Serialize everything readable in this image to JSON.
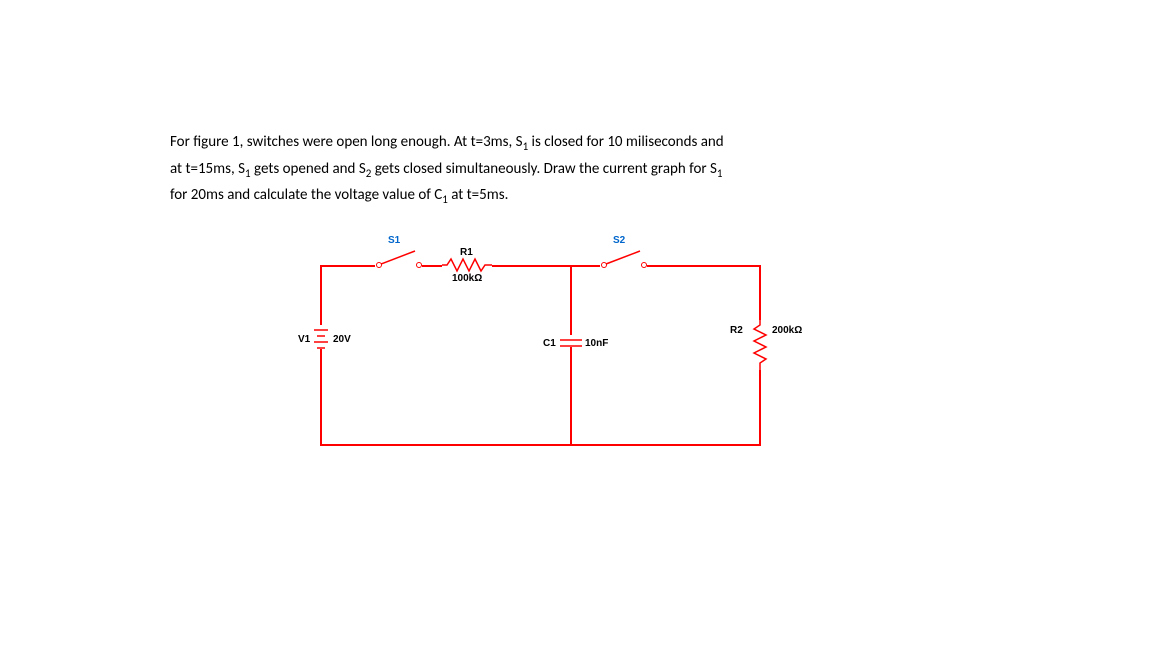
{
  "problem": {
    "line1_a": "For figure 1, switches were open long enough. At t=3ms, S",
    "line1_sub1": "1",
    "line1_b": " is closed for 10 miliseconds and",
    "line2_a": "at t=15ms, S",
    "line2_sub1": "1",
    "line2_b": " gets opened and S",
    "line2_sub2": "2",
    "line2_c": " gets closed simultaneously. Draw the current graph for S",
    "line2_sub3": "1",
    "line3_a": "for 20ms and calculate the voltage value of C",
    "line3_sub1": "1",
    "line3_b": " at t=5ms."
  },
  "circuit": {
    "V1_name": "V1",
    "V1_value": "20V",
    "S1": "S1",
    "S2": "S2",
    "R1_name": "R1",
    "R1_value": "100kΩ",
    "R2_name": "R2",
    "R2_value": "200kΩ",
    "C1_name": "C1",
    "C1_value": "10nF"
  }
}
